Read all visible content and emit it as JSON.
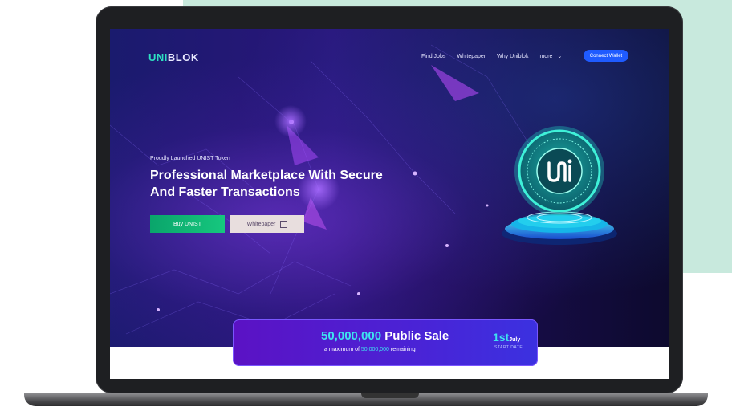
{
  "logo": {
    "text_part1": "UNI",
    "text_part2": "BLOK"
  },
  "nav": {
    "links": [
      "Find Jobs",
      "Whitepaper",
      "Why Uniblok",
      "more"
    ],
    "connect_label": "Connect Wallet"
  },
  "hero": {
    "eyebrow": "Proudly Launched UNIST Token",
    "headline_line1": "Professional Marketplace With Secure",
    "headline_line2": "And Faster Transactions",
    "buy_label": "Buy UNIST",
    "whitepaper_label": "Whitepaper"
  },
  "sale": {
    "amount": "50,000,000",
    "title_rest": " Public Sale",
    "sub_prefix": "a maximum of ",
    "sub_amount": "50,000,000",
    "sub_suffix": " remaining",
    "date_day": "1st",
    "date_month": "July",
    "date_label": "START DATE"
  },
  "colors": {
    "mint_bg": "#c8e9dd",
    "accent_teal": "#2ee0c2",
    "connect_blue": "#1f5bff",
    "buy_green": "#16c77e"
  },
  "icons": [
    "chevron-down-icon",
    "external-link-icon",
    "uni-coin-logo"
  ]
}
